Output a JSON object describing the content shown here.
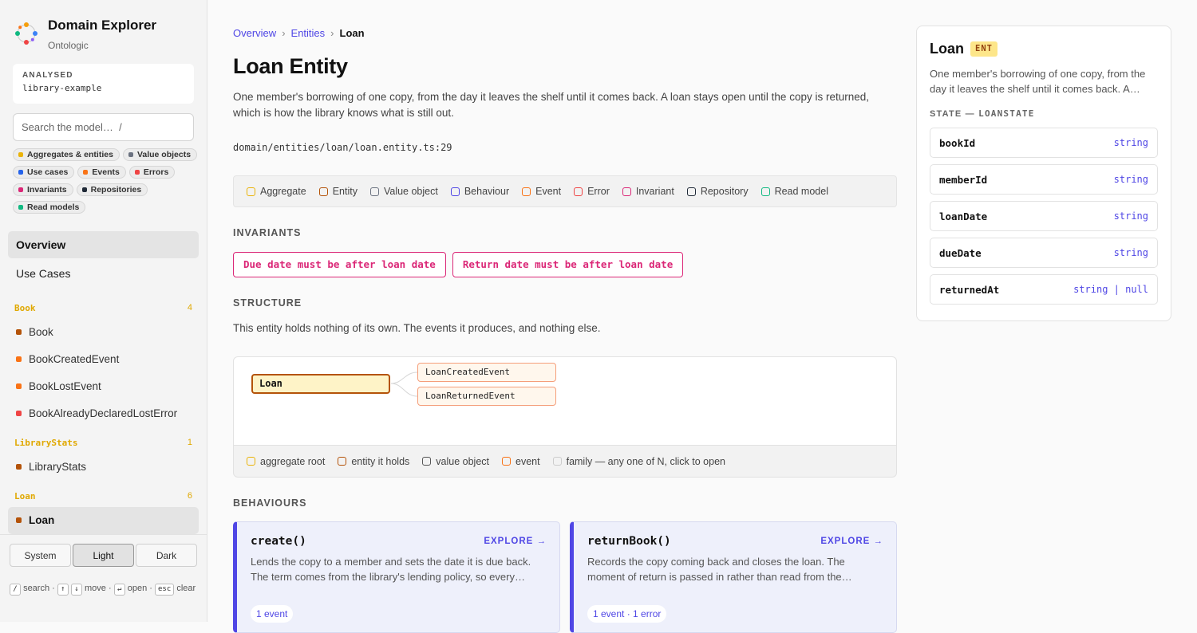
{
  "app": {
    "title": "Domain Explorer",
    "subtitle": "Ontologic"
  },
  "analysed": {
    "label": "ANALYSED",
    "value": "library-example"
  },
  "search": {
    "placeholder": "Search the model…  /"
  },
  "filters": [
    {
      "label": "Aggregates & entities",
      "color": "#eab308"
    },
    {
      "label": "Value objects",
      "color": "#6b7280"
    },
    {
      "label": "Use cases",
      "color": "#2563eb"
    },
    {
      "label": "Events",
      "color": "#f97316"
    },
    {
      "label": "Errors",
      "color": "#ef4444"
    },
    {
      "label": "Invariants",
      "color": "#db2777"
    },
    {
      "label": "Repositories",
      "color": "#1f2937"
    },
    {
      "label": "Read models",
      "color": "#10b981"
    }
  ],
  "nav": {
    "overview": "Overview",
    "use_cases": "Use Cases",
    "groups": [
      {
        "name": "Book",
        "count": "4",
        "items": [
          {
            "label": "Book",
            "color": "#b45309"
          },
          {
            "label": "BookCreatedEvent",
            "color": "#f97316"
          },
          {
            "label": "BookLostEvent",
            "color": "#f97316"
          },
          {
            "label": "BookAlreadyDeclaredLostError",
            "color": "#ef4444"
          }
        ]
      },
      {
        "name": "LibraryStats",
        "count": "1",
        "items": [
          {
            "label": "LibraryStats",
            "color": "#b45309"
          }
        ]
      },
      {
        "name": "Loan",
        "count": "6",
        "items": [
          {
            "label": "Loan",
            "color": "#b45309"
          }
        ]
      }
    ]
  },
  "theme": {
    "system": "System",
    "light": "Light",
    "dark": "Dark",
    "selected": "Light"
  },
  "hints": {
    "search": "search ·",
    "move": "move ·",
    "open": "open ·",
    "clear": "clear",
    "k_slash": "/",
    "k_up": "↑",
    "k_down": "↓",
    "k_enter": "↵",
    "k_esc": "esc"
  },
  "breadcrumb": {
    "overview": "Overview",
    "entities": "Entities",
    "current": "Loan",
    "sep": "›"
  },
  "page": {
    "title": "Loan Entity",
    "description": "One member's borrowing of one copy, from the day it leaves the shelf until it comes back. A loan stays open until the copy is returned, which is how the library knows what is still out.",
    "path": "domain/entities/loan/loan.entity.ts:29"
  },
  "kind_legend": [
    {
      "label": "Aggregate",
      "color": "#eab308"
    },
    {
      "label": "Entity",
      "color": "#b45309"
    },
    {
      "label": "Value object",
      "color": "#6b7280"
    },
    {
      "label": "Behaviour",
      "color": "#4f46e5"
    },
    {
      "label": "Event",
      "color": "#f97316"
    },
    {
      "label": "Error",
      "color": "#ef4444"
    },
    {
      "label": "Invariant",
      "color": "#db2777"
    },
    {
      "label": "Repository",
      "color": "#1f2937"
    },
    {
      "label": "Read model",
      "color": "#10b981"
    }
  ],
  "invariants": {
    "heading": "INVARIANTS",
    "items": [
      "Due date must be after loan date",
      "Return date must be after loan date"
    ]
  },
  "structure": {
    "heading": "STRUCTURE",
    "description": "This entity holds nothing of its own. The events it produces, and nothing else.",
    "root": "Loan",
    "events": [
      "LoanCreatedEvent",
      "LoanReturnedEvent"
    ],
    "legend": [
      {
        "label": "aggregate root",
        "color": "#eab308"
      },
      {
        "label": "entity it holds",
        "color": "#b45309"
      },
      {
        "label": "value object",
        "color": "#555555"
      },
      {
        "label": "event",
        "color": "#f97316"
      },
      {
        "label": "family — any one of N, click to open",
        "color": "#cccccc"
      }
    ]
  },
  "behaviours": {
    "heading": "BEHAVIOURS",
    "explore": "EXPLORE →",
    "items": [
      {
        "name": "create()",
        "description": "Lends the copy to a member and sets the date it is due back. The term comes from the library's lending policy, so every…",
        "pill": "1 event"
      },
      {
        "name": "returnBook()",
        "description": "Records the copy coming back and closes the loan. The moment of return is passed in rather than read from the…",
        "pill": "1 event · 1 error"
      }
    ]
  },
  "panel": {
    "title": "Loan",
    "badge": "ENT",
    "description": "One member's borrowing of one copy, from the day it leaves the shelf until it comes back. A…",
    "state_label": "STATE — ",
    "state_name": "LOANSTATE",
    "fields": [
      {
        "name": "bookId",
        "type": "string"
      },
      {
        "name": "memberId",
        "type": "string"
      },
      {
        "name": "loanDate",
        "type": "string"
      },
      {
        "name": "dueDate",
        "type": "string"
      },
      {
        "name": "returnedAt",
        "type": "string | null"
      }
    ]
  }
}
